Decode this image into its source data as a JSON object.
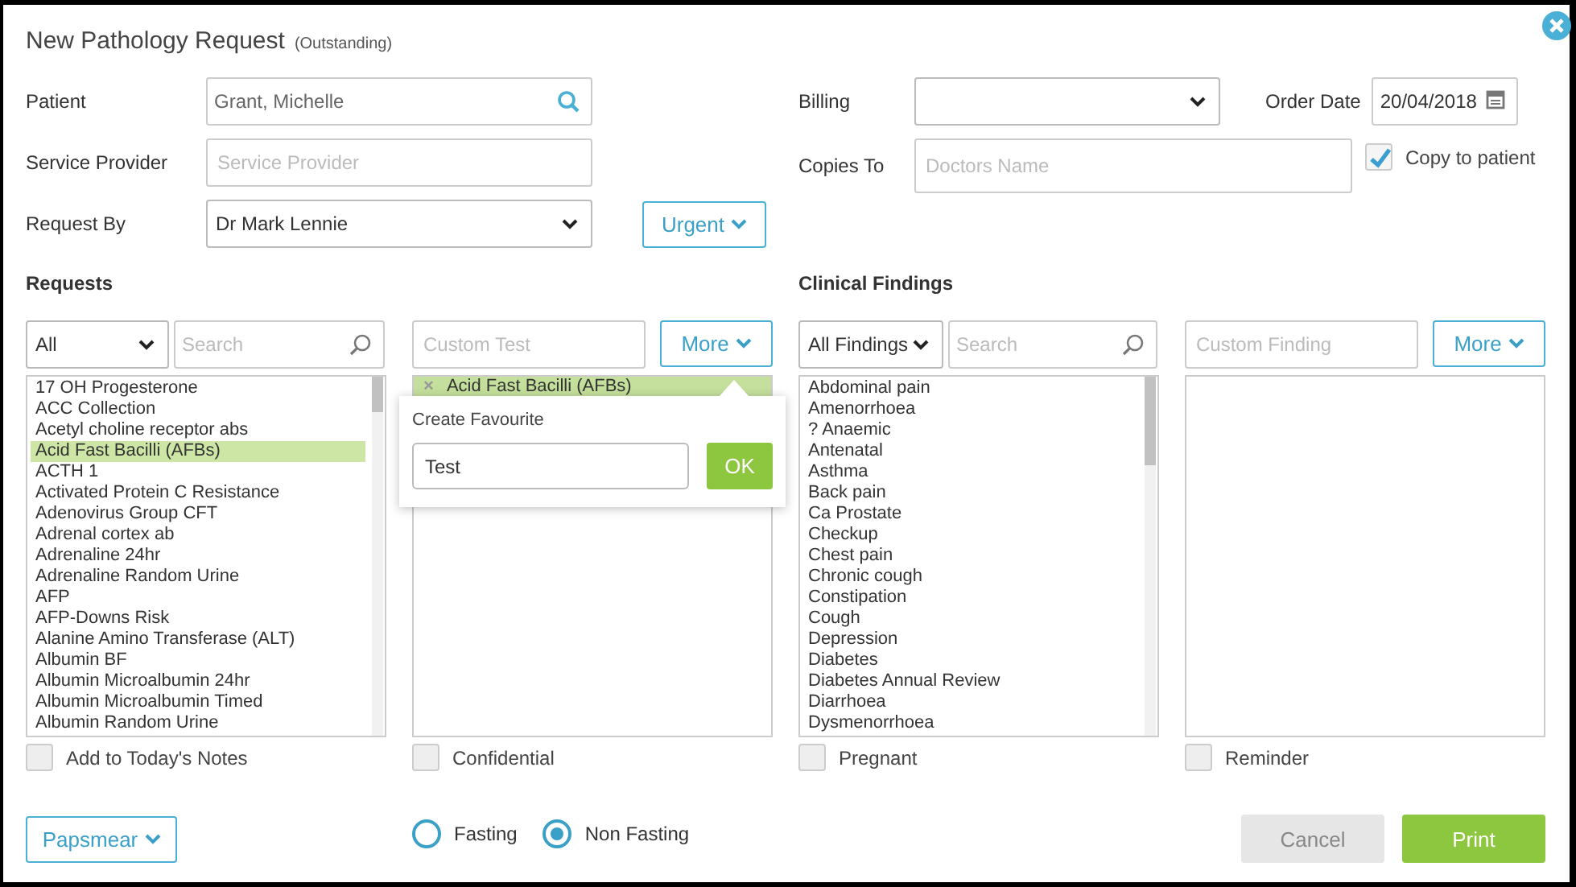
{
  "dialog": {
    "title": "New Pathology Request",
    "status": "(Outstanding)"
  },
  "form": {
    "patient": {
      "label": "Patient",
      "value": "Grant, Michelle"
    },
    "service_provider": {
      "label": "Service Provider",
      "placeholder": "Service Provider"
    },
    "request_by": {
      "label": "Request By",
      "value": "Dr Mark Lennie"
    },
    "urgent_button": "Urgent",
    "billing": {
      "label": "Billing"
    },
    "order_date": {
      "label": "Order Date",
      "value": "20/04/2018"
    },
    "copies_to": {
      "label": "Copies To",
      "placeholder": "Doctors Name"
    },
    "copy_to_patient": {
      "label": "Copy to patient",
      "checked": true
    }
  },
  "requests": {
    "heading": "Requests",
    "filter": "All",
    "search_placeholder": "Search",
    "custom_placeholder": "Custom Test",
    "more_button": "More",
    "items": [
      {
        "label": "17 OH Progesterone",
        "selected": false
      },
      {
        "label": "ACC Collection",
        "selected": false
      },
      {
        "label": "Acetyl choline receptor abs",
        "selected": false
      },
      {
        "label": "Acid Fast Bacilli (AFBs)",
        "selected": true
      },
      {
        "label": "ACTH 1",
        "selected": false
      },
      {
        "label": "Activated Protein C Resistance",
        "selected": false
      },
      {
        "label": "Adenovirus Group CFT",
        "selected": false
      },
      {
        "label": "Adrenal cortex ab",
        "selected": false
      },
      {
        "label": "Adrenaline 24hr",
        "selected": false
      },
      {
        "label": "Adrenaline Random Urine",
        "selected": false
      },
      {
        "label": "AFP",
        "selected": false
      },
      {
        "label": "AFP-Downs Risk",
        "selected": false
      },
      {
        "label": "Alanine Amino Transferase (ALT)",
        "selected": false
      },
      {
        "label": "Albumin BF",
        "selected": false
      },
      {
        "label": "Albumin Microalbumin 24hr",
        "selected": false
      },
      {
        "label": "Albumin Microalbumin Timed",
        "selected": false
      },
      {
        "label": "Albumin Random Urine",
        "selected": false
      }
    ],
    "chosen": [
      {
        "remove": "×",
        "label": "Acid Fast Bacilli (AFBs)"
      }
    ],
    "checkboxes": [
      {
        "label": "Add to Today's Notes",
        "checked": false
      },
      {
        "label": "Confidential",
        "checked": false
      }
    ]
  },
  "favourite_popup": {
    "title": "Create Favourite",
    "value": "Test",
    "ok_button": "OK"
  },
  "clinical_findings": {
    "heading": "Clinical Findings",
    "filter": "All Findings",
    "search_placeholder": "Search",
    "custom_placeholder": "Custom Finding",
    "more_button": "More",
    "items": [
      {
        "label": "Abdominal pain",
        "selected": false
      },
      {
        "label": "Amenorrhoea",
        "selected": false
      },
      {
        "label": "? Anaemic",
        "selected": false
      },
      {
        "label": "Antenatal",
        "selected": false
      },
      {
        "label": "Asthma",
        "selected": false
      },
      {
        "label": "Back pain",
        "selected": false
      },
      {
        "label": "Ca Prostate",
        "selected": false
      },
      {
        "label": "Checkup",
        "selected": false
      },
      {
        "label": "Chest pain",
        "selected": false
      },
      {
        "label": "Chronic cough",
        "selected": false
      },
      {
        "label": "Constipation",
        "selected": false
      },
      {
        "label": "Cough",
        "selected": false
      },
      {
        "label": "Depression",
        "selected": false
      },
      {
        "label": "Diabetes",
        "selected": false
      },
      {
        "label": "Diabetes Annual Review",
        "selected": false
      },
      {
        "label": "Diarrhoea",
        "selected": false
      },
      {
        "label": "Dysmenorrhoea",
        "selected": false
      }
    ],
    "checkboxes": [
      {
        "label": "Pregnant",
        "checked": false
      },
      {
        "label": "Reminder",
        "checked": false
      }
    ]
  },
  "papsmear_button": "Papsmear",
  "fasting": [
    {
      "label": "Fasting",
      "selected": false
    },
    {
      "label": "Non Fasting",
      "selected": true
    }
  ],
  "buttons": [
    {
      "label": "Cancel",
      "kind": "secondary"
    },
    {
      "label": "Print",
      "kind": "primary"
    }
  ]
}
